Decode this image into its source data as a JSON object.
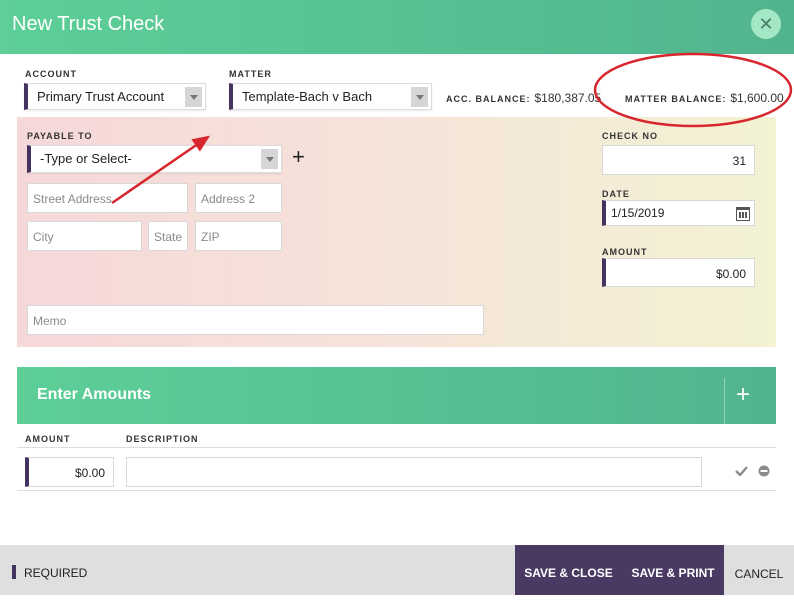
{
  "dialog": {
    "title": "New Trust Check",
    "close_symbol": "✕"
  },
  "top": {
    "account_label": "ACCOUNT",
    "account_value": "Primary Trust Account",
    "matter_label": "MATTER",
    "matter_value": "Template-Bach v Bach",
    "acc_balance_label": "ACC. BALANCE:",
    "acc_balance_value": "$180,387.05",
    "matter_balance_label": "MATTER BALANCE:",
    "matter_balance_value": "$1,600.00"
  },
  "check": {
    "payable_label": "PAYABLE TO",
    "payable_value": "-Type or Select-",
    "add_symbol": "+",
    "street_placeholder": "Street Address",
    "address2_placeholder": "Address 2",
    "city_placeholder": "City",
    "state_placeholder": "State",
    "zip_placeholder": "ZIP",
    "memo_placeholder": "Memo",
    "check_no_label": "CHECK NO",
    "check_no_value": "31",
    "date_label": "DATE",
    "date_value": "1/15/2019",
    "amount_label": "AMOUNT",
    "amount_value": "$0.00"
  },
  "amounts": {
    "title": "Enter Amounts",
    "add_symbol": "+",
    "col_amount": "AMOUNT",
    "col_description": "DESCRIPTION",
    "rows": [
      {
        "amount": "$0.00",
        "description": ""
      }
    ]
  },
  "footer": {
    "required_label": "REQUIRED",
    "save_close_label": "SAVE & CLOSE",
    "save_print_label": "SAVE & PRINT",
    "cancel_label": "CANCEL"
  },
  "colors": {
    "header_green": "#5dcf97",
    "accent_purple": "#44335f",
    "annotation_red": "#d8262e"
  }
}
